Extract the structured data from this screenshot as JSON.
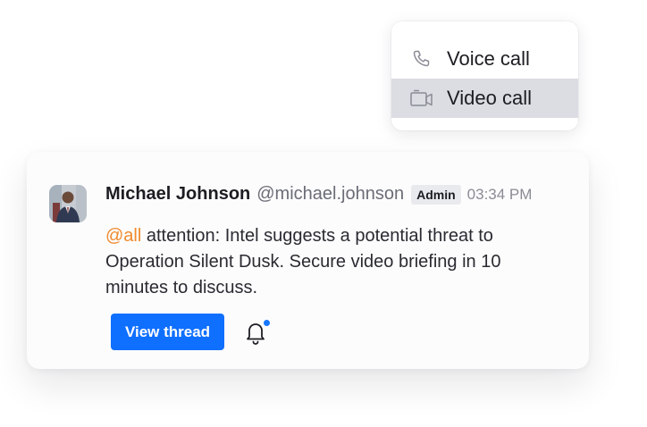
{
  "call_menu": {
    "items": [
      {
        "label": "Voice call",
        "icon": "phone-icon"
      },
      {
        "label": "Video call",
        "icon": "video-camera-icon",
        "selected": true
      }
    ],
    "selected_color": "#dcdde3"
  },
  "message": {
    "author": "Michael Johnson",
    "handle": "@michael.johnson",
    "role": "Admin",
    "time": "03:34 PM",
    "mention": "@all",
    "body": " attention: Intel suggests a potential threat to Operation Silent Dusk. Secure video briefing in 10 minutes to discuss.",
    "view_thread_label": "View thread",
    "has_unread_notification": true
  },
  "colors": {
    "primary": "#0f6fff",
    "mention": "#f08a2c",
    "notification_dot": "#1677ff"
  }
}
